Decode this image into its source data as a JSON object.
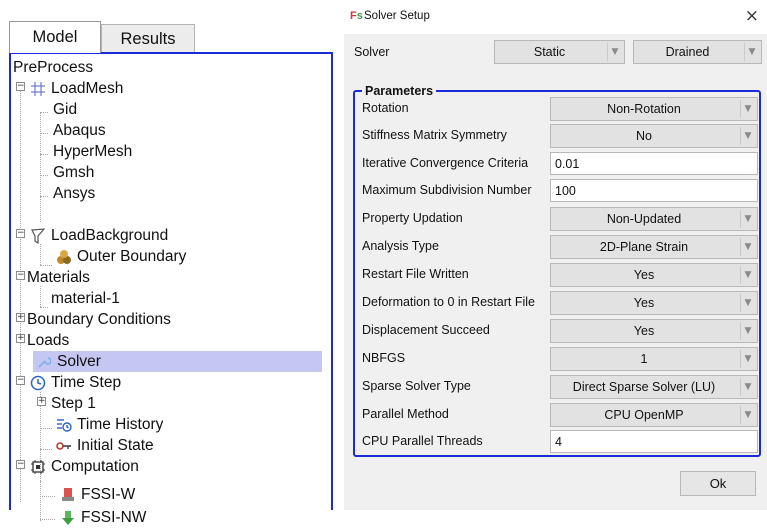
{
  "left_panel": {
    "tabs": [
      {
        "label": "Model",
        "active": true
      },
      {
        "label": "Results",
        "active": false
      }
    ],
    "tree": {
      "preprocess": "PreProcess",
      "loadmesh": {
        "label": "LoadMesh",
        "icon": "grid-icon",
        "expander": "−",
        "children": [
          "Gid",
          "Abaqus",
          "HyperMesh",
          "Gmsh",
          "Ansys"
        ]
      },
      "loadbackground": {
        "label": "LoadBackground",
        "icon": "funnel-icon",
        "expander": "−",
        "children": [
          {
            "label": "Outer Boundary",
            "icon": "boundary-icon"
          }
        ]
      },
      "materials": {
        "label": "Materials",
        "expander": "−",
        "children": [
          "material-1"
        ]
      },
      "boundary_conditions": {
        "label": "Boundary Conditions",
        "expander": "+"
      },
      "loads": {
        "label": "Loads",
        "expander": "+"
      },
      "solver": {
        "label": "Solver",
        "icon": "wrench-icon",
        "selected": true
      },
      "time_step": {
        "label": "Time Step",
        "icon": "clock-icon",
        "expander": "−",
        "children": [
          {
            "label": "Step 1",
            "expander": "+"
          }
        ]
      },
      "time_history": {
        "label": "Time History",
        "icon": "time-history-icon"
      },
      "initial_state": {
        "label": "Initial State",
        "icon": "key-icon"
      },
      "computation": {
        "label": "Computation",
        "icon": "chip-icon",
        "expander": "−",
        "children": [
          {
            "label": "FSSI-W",
            "icon": "fssi-w-icon"
          },
          {
            "label": "FSSI-NW",
            "icon": "fssi-nw-icon"
          }
        ]
      }
    }
  },
  "dialog": {
    "title": "Solver Setup",
    "app_icon_text": {
      "f": "F",
      "s": "s"
    },
    "close_glyph": "×",
    "solver": {
      "label": "Solver",
      "type": "Static",
      "drainage": "Drained"
    },
    "parameters": {
      "legend": "Parameters",
      "rows": [
        {
          "label": "Rotation",
          "kind": "combo",
          "value": "Non-Rotation"
        },
        {
          "label": "Stiffness Matrix Symmetry",
          "kind": "combo",
          "value": "No"
        },
        {
          "label": "Iterative Convergence Criteria",
          "kind": "text",
          "value": "0.01"
        },
        {
          "label": "Maximum Subdivision Number",
          "kind": "text",
          "value": "100"
        },
        {
          "label": "Property Updation",
          "kind": "combo",
          "value": "Non-Updated"
        },
        {
          "label": "Analysis Type",
          "kind": "combo",
          "value": "2D-Plane Strain"
        },
        {
          "label": "Restart File Written",
          "kind": "combo",
          "value": "Yes"
        },
        {
          "label": "Deformation to 0 in Restart File",
          "kind": "combo",
          "value": "Yes"
        },
        {
          "label": "Displacement Succeed",
          "kind": "combo",
          "value": "Yes"
        },
        {
          "label": "NBFGS",
          "kind": "combo",
          "value": "1"
        },
        {
          "label": "Sparse Solver Type",
          "kind": "combo",
          "value": "Direct Sparse Solver (LU)"
        },
        {
          "label": "Parallel Method",
          "kind": "combo",
          "value": "CPU OpenMP"
        },
        {
          "label": "CPU Parallel Threads",
          "kind": "text",
          "value": "4"
        }
      ]
    },
    "ok_label": "Ok"
  },
  "arrow_glyph": "▼",
  "colors": {
    "accent_border": "#1b2bd6",
    "selection": "#c6c6f3"
  }
}
